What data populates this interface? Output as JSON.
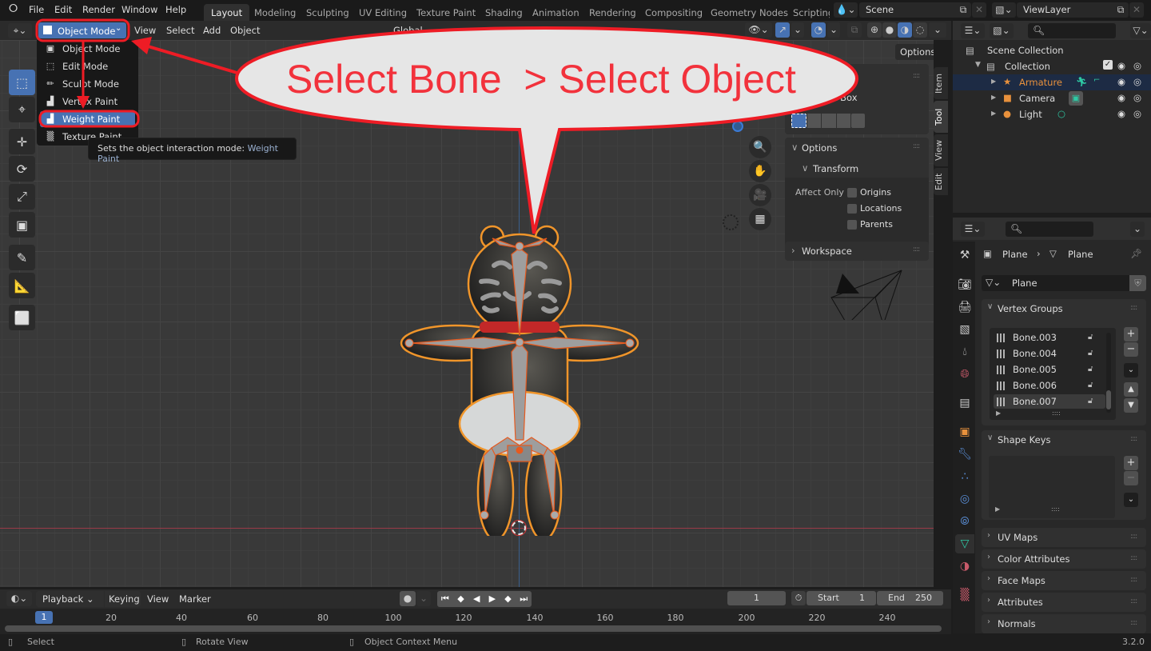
{
  "app": {
    "version": "3.2.0"
  },
  "topbar": {
    "menus": [
      "File",
      "Edit",
      "Render",
      "Window",
      "Help"
    ],
    "workspaces": [
      "Layout",
      "Modeling",
      "Sculpting",
      "UV Editing",
      "Texture Paint",
      "Shading",
      "Animation",
      "Rendering",
      "Compositing",
      "Geometry Nodes",
      "Scripting"
    ],
    "active_workspace": "Layout",
    "scene": "Scene",
    "view_layer": "ViewLayer"
  },
  "viewport_header": {
    "mode": "Object Mode",
    "menus": [
      "View",
      "Select",
      "Add",
      "Object"
    ],
    "transform_orientation": "Global",
    "options_label": "Options"
  },
  "mode_menu": {
    "items": [
      {
        "label": "Object Mode",
        "icon": "object-mode-icon"
      },
      {
        "label": "Edit Mode",
        "icon": "edit-mode-icon"
      },
      {
        "label": "Sculpt Mode",
        "icon": "sculpt-mode-icon"
      },
      {
        "label": "Vertex Paint",
        "icon": "vertex-paint-icon"
      },
      {
        "label": "Weight Paint",
        "icon": "weight-paint-icon"
      },
      {
        "label": "Texture Paint",
        "icon": "texture-paint-icon"
      }
    ],
    "highlighted": "Weight Paint"
  },
  "tooltip": {
    "text": "Sets the object interaction mode:",
    "value": "Weight Paint"
  },
  "annotation": {
    "callout": "Select Bone  > Select Object",
    "color": "#f2323c"
  },
  "tool_panel": {
    "tool_name": "Select Box",
    "options_title": "Options",
    "transform_title": "Transform",
    "affect_only_label": "Affect Only",
    "checkboxes": [
      "Origins",
      "Locations",
      "Parents"
    ],
    "workspace_title": "Workspace",
    "side_tabs": [
      "Item",
      "Tool",
      "View",
      "Edit"
    ],
    "active_side_tab": "Tool"
  },
  "outliner": {
    "root": "Scene Collection",
    "collection": "Collection",
    "objects": [
      {
        "name": "Armature",
        "selected": true,
        "color": "#e8913c"
      },
      {
        "name": "Camera",
        "selected": false
      },
      {
        "name": "Light",
        "selected": false
      }
    ]
  },
  "properties": {
    "breadcrumb": [
      "Plane",
      "Plane"
    ],
    "mesh_name": "Plane",
    "vertex_groups_title": "Vertex Groups",
    "vertex_groups": [
      "Bone.003",
      "Bone.004",
      "Bone.005",
      "Bone.006",
      "Bone.007"
    ],
    "active_vertex_group": "Bone.007",
    "shape_keys_title": "Shape Keys",
    "collapsed_panels": [
      "UV Maps",
      "Color Attributes",
      "Face Maps",
      "Attributes",
      "Normals"
    ]
  },
  "timeline": {
    "menus": [
      "Playback",
      "Keying",
      "View",
      "Marker"
    ],
    "current_frame": "1",
    "start_label": "Start",
    "start": "1",
    "end_label": "End",
    "end": "250",
    "ticks": [
      "20",
      "40",
      "60",
      "80",
      "100",
      "120",
      "140",
      "160",
      "180",
      "200",
      "220",
      "240"
    ]
  },
  "statusbar": {
    "items": [
      "Select",
      "Rotate View",
      "Object Context Menu"
    ],
    "version": "3.2.0"
  }
}
